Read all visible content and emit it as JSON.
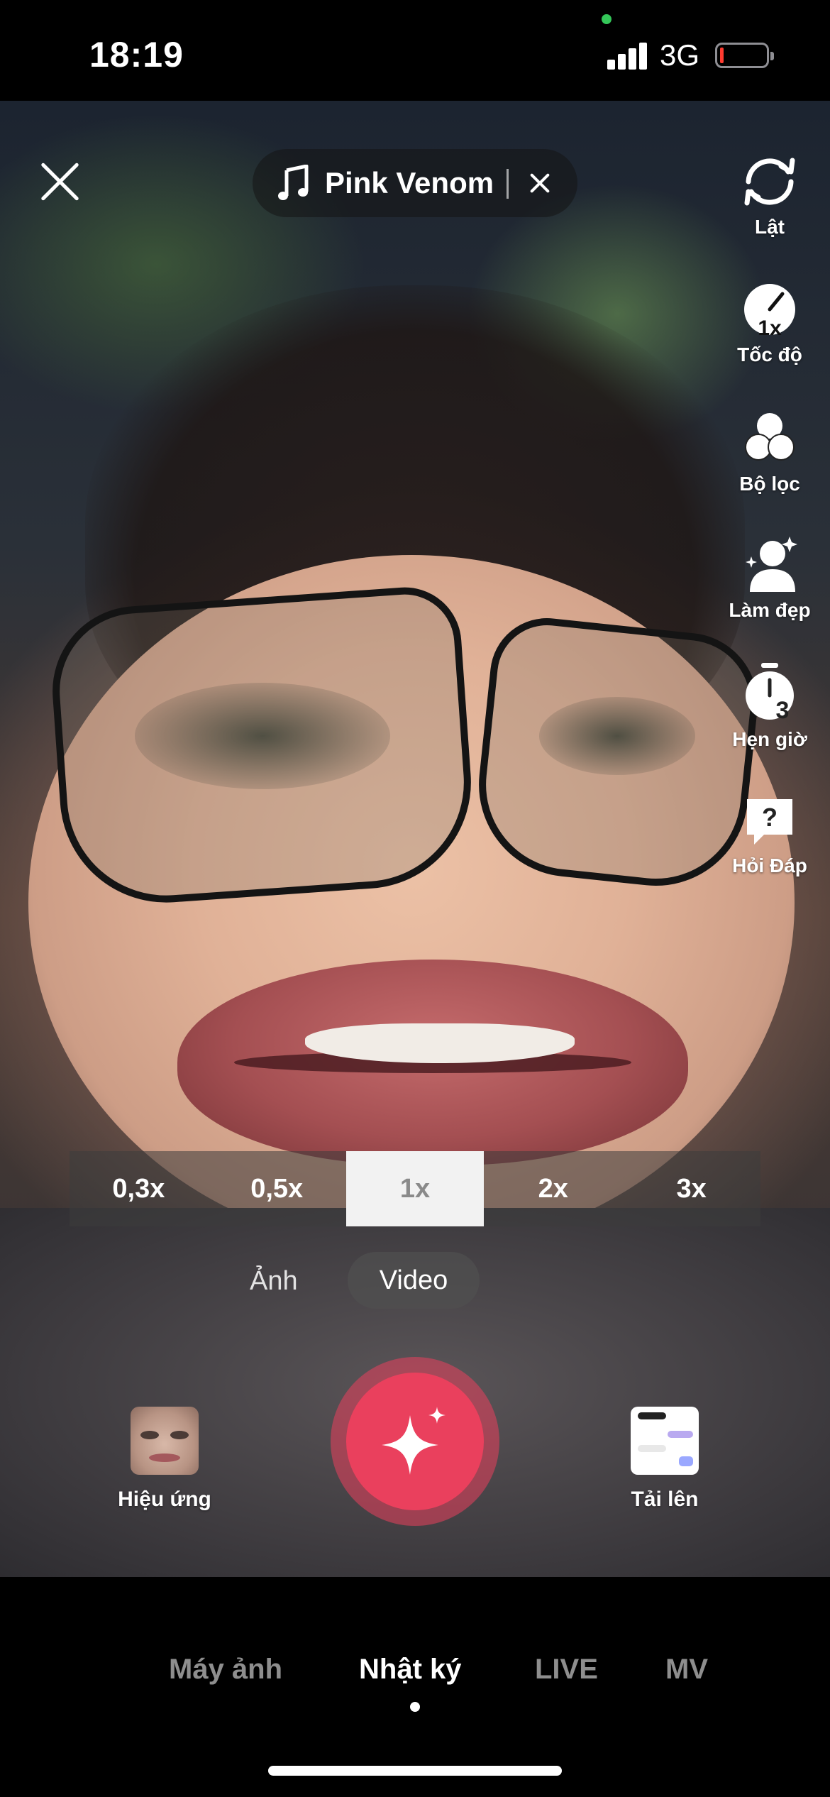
{
  "status_bar": {
    "time": "18:19",
    "network": "3G",
    "battery_level": 0.08,
    "battery_color": "#ff3b30",
    "camera_indicator_color": "#34c759"
  },
  "top_bar": {
    "close_icon": "close-icon",
    "sound": {
      "icon": "music-note-icon",
      "title": "Pink Venom",
      "remove_icon": "close-icon"
    }
  },
  "tools": [
    {
      "id": "flip",
      "label": "Lật",
      "icon": "flip-camera-icon"
    },
    {
      "id": "speed",
      "label": "Tốc độ",
      "icon": "speed-icon",
      "badge": "1x"
    },
    {
      "id": "filters",
      "label": "Bộ lọc",
      "icon": "filters-icon"
    },
    {
      "id": "beautify",
      "label": "Làm đẹp",
      "icon": "beautify-icon"
    },
    {
      "id": "timer",
      "label": "Hẹn giờ",
      "icon": "timer-icon",
      "badge": "3"
    },
    {
      "id": "qa",
      "label": "Hỏi Đáp",
      "icon": "question-bubble-icon",
      "badge": "?"
    }
  ],
  "zoom": {
    "options": [
      "0,3x",
      "0,5x",
      "1x",
      "2x",
      "3x"
    ],
    "selected": "1x"
  },
  "capture_modes": {
    "photo": "Ảnh",
    "video": "Video",
    "selected": "Video"
  },
  "bottom_controls": {
    "effects_label": "Hiệu ứng",
    "upload_label": "Tải lên",
    "record_icon": "sparkle-icon",
    "record_color": "#ea405d"
  },
  "bottom_nav": {
    "items": [
      "Máy ảnh",
      "Nhật ký",
      "LIVE",
      "MV"
    ],
    "selected": "Nhật ký"
  }
}
